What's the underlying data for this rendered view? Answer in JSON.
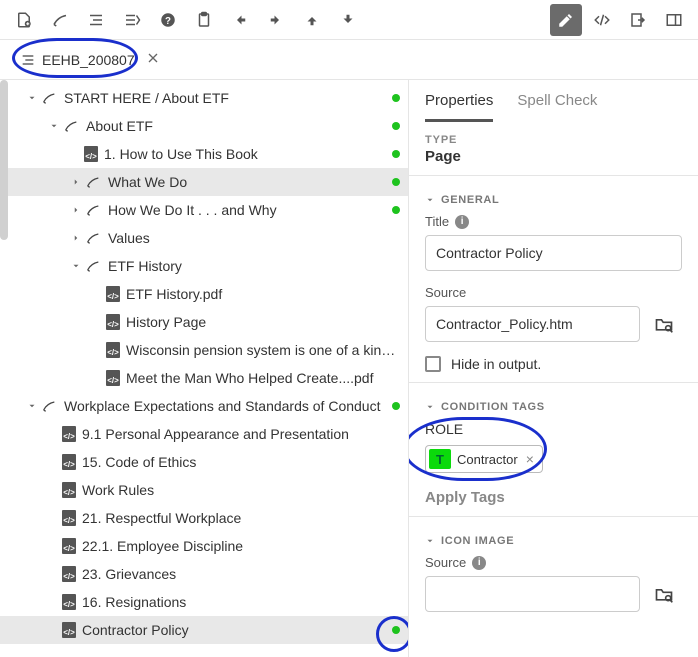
{
  "tab": {
    "name": "EEHB_200807"
  },
  "tree": [
    {
      "depth": 0,
      "chev": "down",
      "icon": "topic",
      "label": "START HERE / About ETF",
      "dot": true
    },
    {
      "depth": 1,
      "chev": "down",
      "icon": "topic",
      "label": "About ETF",
      "dot": true
    },
    {
      "depth": 2,
      "chev": null,
      "icon": "file",
      "label": "1. How to Use This Book",
      "dot": true
    },
    {
      "depth": 2,
      "chev": "right",
      "icon": "topic",
      "label": "What We Do",
      "dot": true,
      "selected": true
    },
    {
      "depth": 2,
      "chev": "right",
      "icon": "topic",
      "label": "How We Do It . . . and Why",
      "dot": true
    },
    {
      "depth": 2,
      "chev": "right",
      "icon": "topic",
      "label": "Values"
    },
    {
      "depth": 2,
      "chev": "down",
      "icon": "topic",
      "label": "ETF History"
    },
    {
      "depth": 3,
      "chev": null,
      "icon": "file",
      "label": "ETF History.pdf"
    },
    {
      "depth": 3,
      "chev": null,
      "icon": "file",
      "label": "History Page"
    },
    {
      "depth": 3,
      "chev": null,
      "icon": "file",
      "label": "Wisconsin pension system is one of a kind.pdf"
    },
    {
      "depth": 3,
      "chev": null,
      "icon": "file",
      "label": "Meet the Man Who Helped Create....pdf"
    },
    {
      "depth": 0,
      "chev": "down",
      "icon": "topic",
      "label": "Workplace Expectations and Standards of Conduct",
      "dot": true
    },
    {
      "depth": 1,
      "chev": null,
      "icon": "file",
      "label": "9.1 Personal Appearance and Presentation"
    },
    {
      "depth": 1,
      "chev": null,
      "icon": "file",
      "label": "15. Code of Ethics"
    },
    {
      "depth": 1,
      "chev": null,
      "icon": "file",
      "label": "Work Rules"
    },
    {
      "depth": 1,
      "chev": null,
      "icon": "file",
      "label": "21. Respectful Workplace"
    },
    {
      "depth": 1,
      "chev": null,
      "icon": "file",
      "label": "22.1. Employee Discipline"
    },
    {
      "depth": 1,
      "chev": null,
      "icon": "file",
      "label": "23. Grievances"
    },
    {
      "depth": 1,
      "chev": null,
      "icon": "file",
      "label": "16. Resignations"
    },
    {
      "depth": 1,
      "chev": null,
      "icon": "file",
      "label": "Contractor Policy",
      "dot": true,
      "highlight": true
    }
  ],
  "right": {
    "tabs": {
      "properties": "Properties",
      "spellcheck": "Spell Check"
    },
    "type_label": "TYPE",
    "type_value": "Page",
    "general": {
      "head": "GENERAL",
      "title_label": "Title",
      "title_value": "Contractor Policy",
      "source_label": "Source",
      "source_value": "Contractor_Policy.htm",
      "hide_label": "Hide in output."
    },
    "condition": {
      "head": "CONDITION TAGS",
      "role_label": "ROLE",
      "tag_letter": "T",
      "tag_name": "Contractor",
      "apply": "Apply Tags"
    },
    "icon_image": {
      "head": "ICON IMAGE",
      "source_label": "Source"
    }
  }
}
